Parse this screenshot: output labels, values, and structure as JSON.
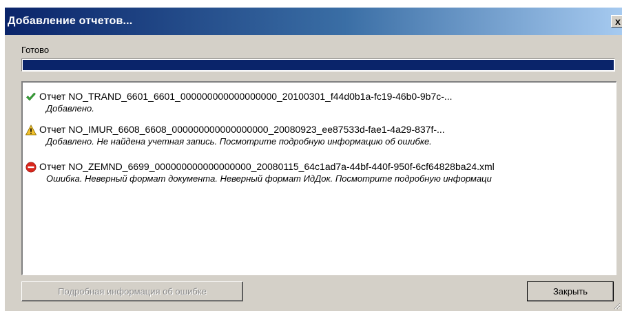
{
  "window": {
    "title": "Добавление отчетов...",
    "close_glyph": "x"
  },
  "status": {
    "label": "Готово",
    "progress": 1.0
  },
  "log": {
    "entries": [
      {
        "icon": "check-icon",
        "title": "Отчет NO_TRAND_6601_6601_000000000000000000_20100301_f44d0b1a-fc19-46b0-9b7c-...",
        "message": "Добавлено."
      },
      {
        "icon": "warning-icon",
        "title": "Отчет NO_IMUR_6608_6608_000000000000000000_20080923_ee87533d-fae1-4a29-837f-...",
        "message": "Добавлено. Не найдена учетная запись. Посмотрите подробную информацию об ошибке."
      },
      {
        "icon": "error-icon",
        "title": "Отчет NO_ZEMND_6699_000000000000000000_20080115_64c1ad7a-44bf-440f-950f-6cf64828ba24.xml",
        "message": "Ошибка. Неверный формат документа. Неверный формат ИдДок. Посмотрите подробную информаци"
      }
    ]
  },
  "buttons": {
    "details_label": "Подробная информация об ошибке",
    "details_enabled": false,
    "close_label": "Закрыть"
  },
  "colors": {
    "success": "#3aa83a",
    "warning": "#f2c12e",
    "error": "#d9261c",
    "progress": "#0a246a"
  }
}
